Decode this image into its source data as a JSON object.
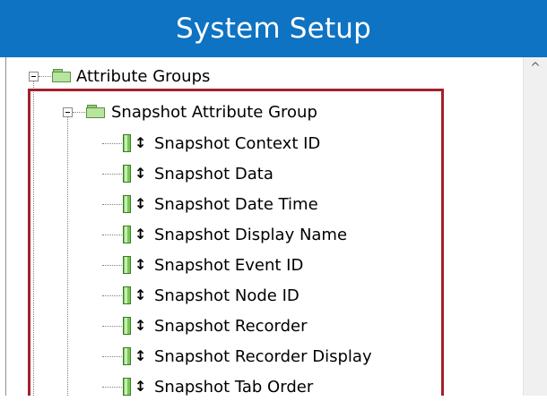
{
  "window": {
    "title": "System Setup",
    "accent_color": "#0e73c2",
    "highlight_color": "#a3202a"
  },
  "tree": {
    "root": {
      "label": "Attribute Groups",
      "expander": "collapse",
      "icon": "folder-icon"
    },
    "group": {
      "label": "Snapshot Attribute Group",
      "expander": "collapse",
      "icon": "folder-icon"
    },
    "attributes": [
      {
        "label": "Snapshot Context ID",
        "icon": "attribute-icon"
      },
      {
        "label": "Snapshot Data",
        "icon": "attribute-icon"
      },
      {
        "label": "Snapshot Date Time",
        "icon": "attribute-icon"
      },
      {
        "label": "Snapshot Display Name",
        "icon": "attribute-icon"
      },
      {
        "label": "Snapshot Event ID",
        "icon": "attribute-icon"
      },
      {
        "label": "Snapshot Node ID",
        "icon": "attribute-icon"
      },
      {
        "label": "Snapshot Recorder",
        "icon": "attribute-icon"
      },
      {
        "label": "Snapshot Recorder Display",
        "icon": "attribute-icon"
      },
      {
        "label": "Snapshot Tab Order",
        "icon": "attribute-icon"
      }
    ]
  },
  "scrollbar": {
    "up_icon": "chevron-up-icon",
    "up_glyph": "^"
  }
}
